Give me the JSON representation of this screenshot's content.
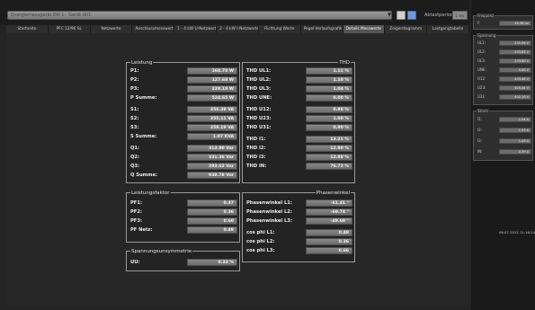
{
  "top": {
    "device": "Energiemessgerät EM 1 · Gerät 001",
    "interval_label": "Abtastperiode",
    "interval_value": "1 sec"
  },
  "tabs": [
    "Startseite",
    "PFC 12/96 SL",
    "Netzwerte",
    "Anschlussmesswerte",
    "1 - 4 kW U-Netzwerte",
    "2 - 4 kW I-Netzwerte",
    "Richtung Werte",
    "Pegel-Verlaufsgrafik",
    "Details Messwerte",
    "Zeigerdiagramm",
    "Lastgangtabelle"
  ],
  "active_tab": 8,
  "leistung": {
    "title": "Leistung",
    "rows": [
      {
        "label": "P1:",
        "value": "168.78 W"
      },
      {
        "label": "P2:",
        "value": "127.68 W"
      },
      {
        "label": "P3:",
        "value": "228.19 W"
      },
      {
        "label": "P Summe:",
        "value": "524.65 W"
      },
      {
        "label": "S1:",
        "value": "356.38 VA"
      },
      {
        "label": "S2:",
        "value": "355.11 VA"
      },
      {
        "label": "S3:",
        "value": "358.19 VA"
      },
      {
        "label": "S Summe:",
        "value": "1.07 KVA"
      },
      {
        "label": "Q1:",
        "value": "313.80 Var"
      },
      {
        "label": "Q2:",
        "value": "331.36 Var"
      },
      {
        "label": "Q3:",
        "value": "293.62 Var"
      },
      {
        "label": "Q Summe:",
        "value": "938.78 Var"
      }
    ]
  },
  "thd": {
    "title": "THD",
    "rows": [
      {
        "label": "THD UL1:",
        "value": "1.11 %"
      },
      {
        "label": "THD UL2:",
        "value": "1.10 %"
      },
      {
        "label": "THD UL3:",
        "value": "1.04 %"
      },
      {
        "label": "THD UNE:",
        "value": "0.00 %"
      },
      {
        "label": "THD U12:",
        "value": "0.98 %"
      },
      {
        "label": "THD U23:",
        "value": "1.00 %"
      },
      {
        "label": "THD U31:",
        "value": "0.90 %"
      },
      {
        "label": "THD I1:",
        "value": "13.21 %"
      },
      {
        "label": "THD I2:",
        "value": "12.80 %"
      },
      {
        "label": "THD I3:",
        "value": "12.88 %"
      },
      {
        "label": "THD IN:",
        "value": "76.72 %"
      }
    ]
  },
  "leistungsfaktor": {
    "title": "Leistungsfaktor",
    "rows": [
      {
        "label": "PF1:",
        "value": "0.47"
      },
      {
        "label": "PF2:",
        "value": "0.36"
      },
      {
        "label": "PF3:",
        "value": "0.60"
      },
      {
        "label": "PF Netz:",
        "value": "0.49"
      }
    ]
  },
  "phasenwinkel": {
    "title": "Phasenwinkel",
    "rows": [
      {
        "label": "Phasenwinkel L1:",
        "value": "-61.41 °"
      },
      {
        "label": "Phasenwinkel L2:",
        "value": "-69.74 °"
      },
      {
        "label": "Phasenwinkel L3:",
        "value": "-49.68 °"
      },
      {
        "label": "cos phi L1:",
        "value": "0.48"
      },
      {
        "label": "cos phi L2:",
        "value": "0.36"
      },
      {
        "label": "cos phi L3:",
        "value": "0.66"
      }
    ]
  },
  "asym": {
    "title": "Spannungsunsymmetrie",
    "label": "UU:",
    "value": "0.33 %"
  },
  "sidebar": {
    "frequenz": {
      "title": "Frequenz",
      "rows": [
        {
          "label": "f:",
          "value": "49.98 Hz"
        }
      ]
    },
    "spannung": {
      "title": "Spannung",
      "rows": [
        {
          "label": "UL1:",
          "value": "231.99 V"
        },
        {
          "label": "UL2:",
          "value": "233.63 V"
        },
        {
          "label": "UL3:",
          "value": "233.80 V"
        },
        {
          "label": "UNE:",
          "value": "0.00 V"
        },
        {
          "label": "U12:",
          "value": "403.46 V"
        },
        {
          "label": "U23:",
          "value": "405.44 V"
        },
        {
          "label": "U31:",
          "value": "402.10 V"
        }
      ]
    },
    "strom": {
      "title": "Strom",
      "rows": [
        {
          "label": "I1:",
          "value": "1.54 A"
        },
        {
          "label": "I2:",
          "value": "1.53 A"
        },
        {
          "label": "I3:",
          "value": "1.49 A"
        },
        {
          "label": "IN:",
          "value": "0.39 A"
        }
      ]
    },
    "timestamp": "06.07.2012 11:16:14"
  }
}
